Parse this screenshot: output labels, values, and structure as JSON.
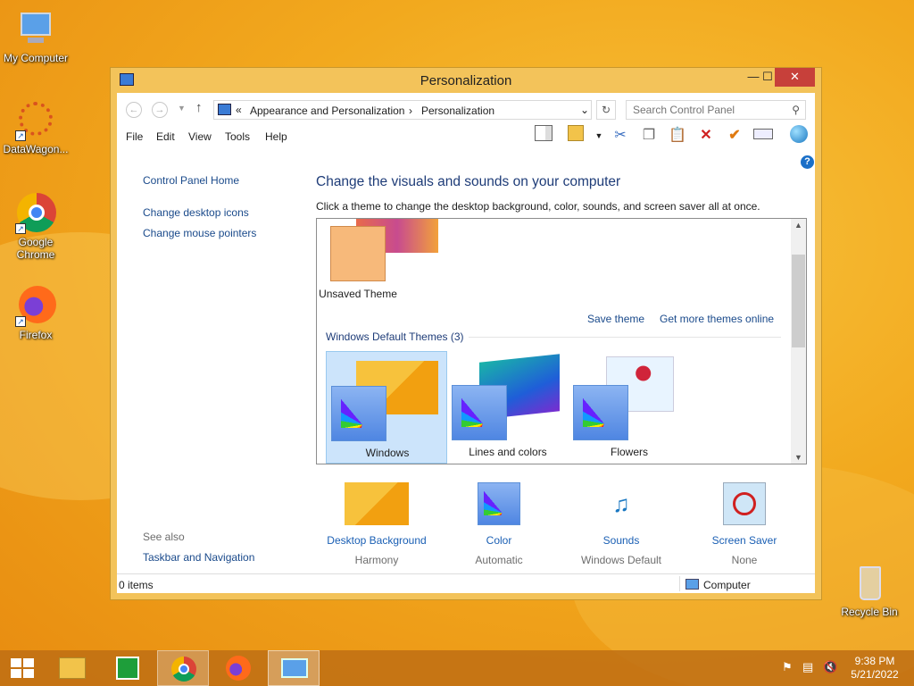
{
  "desktop": {
    "icons": [
      {
        "label": "My Computer",
        "icon": "computer-icon"
      },
      {
        "label": "DataWagon...",
        "icon": "datawagon-icon"
      },
      {
        "label": "Google Chrome",
        "icon": "chrome-icon"
      },
      {
        "label": "Firefox",
        "icon": "firefox-icon"
      },
      {
        "label": "Recycle Bin",
        "icon": "recycle-bin-icon"
      }
    ]
  },
  "window": {
    "title": "Personalization",
    "controls": {
      "minimize": "—",
      "maximize": "☐",
      "close": "✕"
    }
  },
  "address": {
    "prefix": "«",
    "crumbs": [
      "Appearance and Personalization",
      "Personalization"
    ],
    "search_placeholder": "Search Control Panel"
  },
  "menu": [
    "File",
    "Edit",
    "View",
    "Tools",
    "Help"
  ],
  "left_pane": {
    "home": "Control Panel Home",
    "links": [
      "Change desktop icons",
      "Change mouse pointers"
    ],
    "see_also_title": "See also",
    "see_also": [
      "Taskbar and Navigation"
    ]
  },
  "main": {
    "heading": "Change the visuals and sounds on your computer",
    "subheading": "Click a theme to change the desktop background, color, sounds, and screen saver all at once.",
    "unsaved_theme": "Unsaved Theme",
    "save_theme": "Save theme",
    "get_more": "Get more themes online",
    "group_title": "Windows Default Themes (3)",
    "themes": [
      "Windows",
      "Lines and colors",
      "Flowers"
    ]
  },
  "bottom_settings": [
    {
      "name": "Desktop Background",
      "value": "Harmony"
    },
    {
      "name": "Color",
      "value": "Automatic"
    },
    {
      "name": "Sounds",
      "value": "Windows Default"
    },
    {
      "name": "Screen Saver",
      "value": "None"
    }
  ],
  "statusbar": {
    "items": "0 items",
    "location": "Computer"
  },
  "taskbar": {
    "time": "9:38 PM",
    "date": "5/21/2022"
  }
}
